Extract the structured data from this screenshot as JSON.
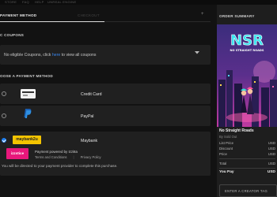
{
  "top_nav": {
    "items": [
      "STORE",
      "FAQ",
      "HELP",
      "UNREAL ENGINE"
    ]
  },
  "tabs": {
    "active_label": "PAYMENT METHOD",
    "inactive_label": "CHECKOUT",
    "plus_label": "+"
  },
  "coupons": {
    "heading": "C COUPONS",
    "text_before": "No eligible Coupons, click ",
    "link_text": "here",
    "text_after": " to view all coupons"
  },
  "payment": {
    "heading": "OOSE A PAYMENT METHOD",
    "methods": [
      {
        "label": "Credit Card",
        "selected": false,
        "icon": "credit-card-icon"
      },
      {
        "label": "PayPal",
        "selected": false,
        "icon": "paypal-icon"
      },
      {
        "label": "Maybank",
        "selected": true,
        "icon": "maybank-logo"
      }
    ],
    "maybank_logo_text": "maybank2u",
    "izzi_logo_text": "izzstice",
    "powered_by": "Payment powered by Izzi8a",
    "terms_label": "Terms and Conditions",
    "separator": "|",
    "privacy_label": "Privacy Policy",
    "redirect_note": "You will be directed to your payment provider to complete this purchase."
  },
  "summary": {
    "heading": "ORDER SUMMARY",
    "cover_logo_text": "NSR",
    "cover_subtitle": "NO STRAIGHT ROADS",
    "game_title": "No Straight Roads",
    "developer": "By Sold Out",
    "list_price_label": "List Price",
    "list_price_value": "USD",
    "discount_label": "Discount",
    "discount_value": "USD",
    "price_label": "Price",
    "price_value": "USD",
    "total_label": "Total",
    "total_value": "USD",
    "you_pay_label": "You Pay",
    "you_pay_value": "USD",
    "creator_tag_label": "ENTER A CREATOR TAG"
  },
  "colors": {
    "accent": "#1c7ef0",
    "link": "#3b89f0",
    "maybank": "#f4c400",
    "izzi": "#e8177b",
    "panel": "#202020",
    "background": "#121212"
  }
}
